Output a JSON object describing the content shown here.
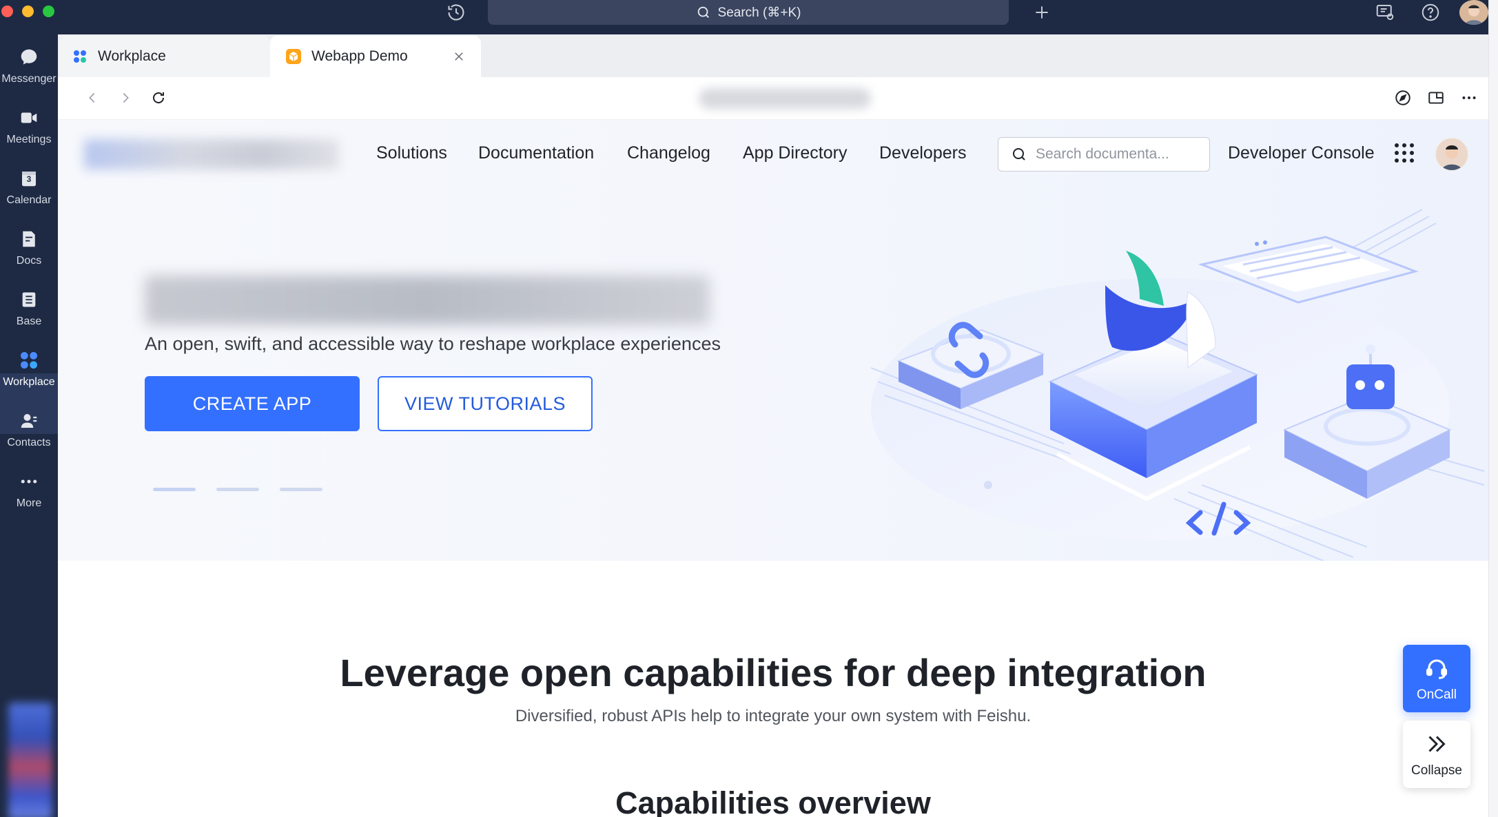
{
  "titlebar": {
    "search_label": "Search (⌘+K)",
    "icons": [
      "history-icon",
      "add-tab-icon",
      "device-icon",
      "help-icon"
    ]
  },
  "rail": {
    "items": [
      {
        "label": "Messenger",
        "icon": "messenger-icon"
      },
      {
        "label": "Meetings",
        "icon": "video-camera-icon"
      },
      {
        "label": "Calendar",
        "icon": "calendar-icon",
        "badge": "3"
      },
      {
        "label": "Docs",
        "icon": "docs-icon"
      },
      {
        "label": "Base",
        "icon": "base-icon"
      },
      {
        "label": "Workplace",
        "icon": "workplace-icon",
        "active": true
      },
      {
        "label": "Contacts",
        "icon": "contacts-icon"
      },
      {
        "label": "More",
        "icon": "more-icon"
      }
    ]
  },
  "tabs": [
    {
      "label": "Workplace",
      "icon": "workplace-icon"
    },
    {
      "label": "Webapp Demo",
      "icon": "webapp-cube-icon",
      "active": true
    }
  ],
  "site": {
    "nav": [
      "Solutions",
      "Documentation",
      "Changelog",
      "App Directory",
      "Developers"
    ],
    "search_placeholder": "Search documenta...",
    "console_label": "Developer Console",
    "hero": {
      "subtitle": "An open, swift, and accessible way to reshape workplace experiences",
      "primary_cta": "CREATE APP",
      "secondary_cta": "VIEW TUTORIALS"
    },
    "section": {
      "title": "Leverage open capabilities for deep integration",
      "subtitle": "Diversified, robust APIs help to integrate your own system with Feishu.",
      "overview_title": "Capabilities overview"
    }
  },
  "floating": {
    "oncall_label": "OnCall",
    "collapse_label": "Collapse"
  },
  "colors": {
    "brand_blue": "#3370ff",
    "rail_bg": "#1e2a44",
    "text_primary": "#1f2329"
  }
}
